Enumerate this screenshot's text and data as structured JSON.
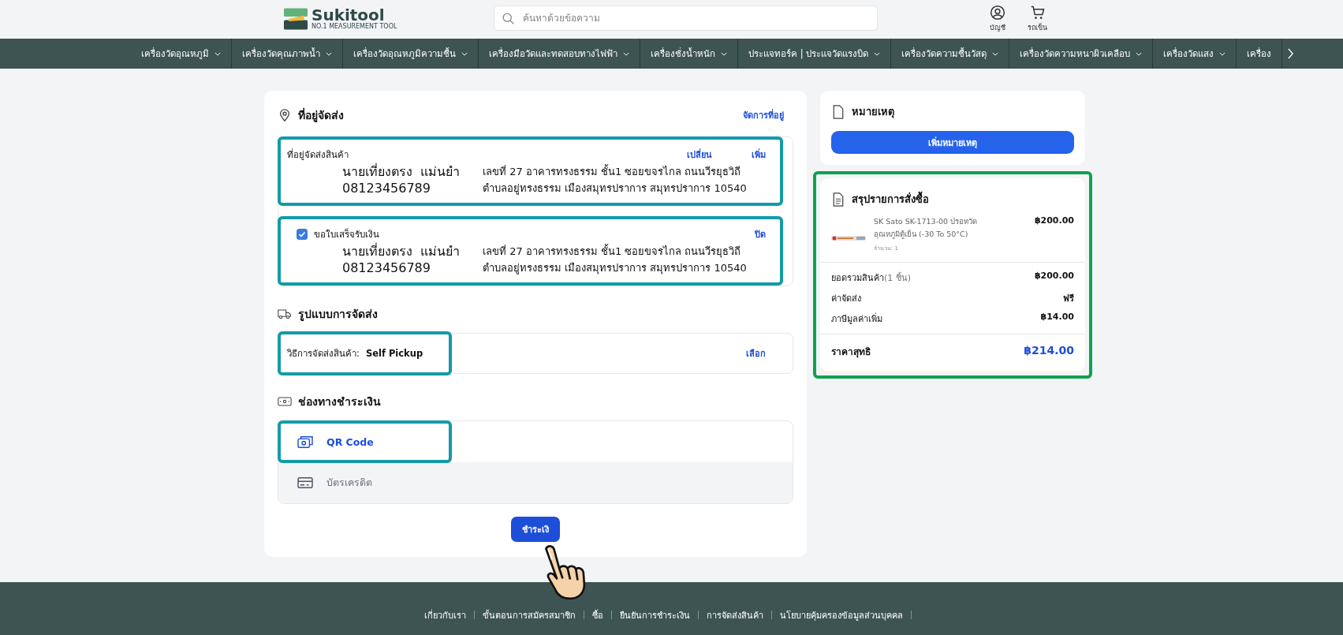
{
  "header": {
    "logo": {
      "name": "Sukitool",
      "tagline": "NO.1 MEASUREMENT TOOL"
    },
    "search": {
      "placeholder": "ค้นหาด้วยข้อความ"
    },
    "actions": [
      {
        "label": "บัญชี",
        "kind": "account"
      },
      {
        "label": "รถเข็น",
        "kind": "cart"
      }
    ]
  },
  "nav": {
    "items": [
      {
        "label": "เครื่องวัดอุณหภูมิ",
        "caret": true
      },
      {
        "label": "เครื่องวัดคุณภาพน้ำ",
        "caret": true
      },
      {
        "label": "เครื่องวัดอุณหภูมิความชื้น",
        "caret": true
      },
      {
        "label": "เครื่องมือวัดและทดสอบทางไฟฟ้า",
        "caret": true
      },
      {
        "label": "เครื่องชั่งน้ำหนัก",
        "caret": true
      },
      {
        "label": "ประแจทอร์ค | ประแจวัดแรงบิด",
        "caret": true
      },
      {
        "label": "เครื่องวัดความชื้นวัสดุ",
        "caret": true
      },
      {
        "label": "เครื่องวัดความหนาผิวเคลือบ",
        "caret": true
      },
      {
        "label": "เครื่องวัดแสง",
        "caret": true
      },
      {
        "label": "เครื่อง",
        "caret": false
      }
    ]
  },
  "address": {
    "title": "ที่อยู่จัดส่ง",
    "manage_link": "จัดการที่อยู่",
    "shipping_block": {
      "label": "ที่อยู่จัดส่งสินค้า",
      "links": [
        "เปลี่ยน",
        "เพิ่ม"
      ],
      "name": "นายเที่ยงตรง  แม่นยำ",
      "phone": "08123456789",
      "address_lines": [
        "เลขที่ 27 อาคารทรงธรรม ชั้น1 ซอยขจรไกล ถนนวีรยุธวิถี",
        "ตำบลอยู่ทรงธรรม เมืองสมุทรปราการ สมุทรปราการ 10540"
      ],
      "highlighted": true
    },
    "invoice_block": {
      "checked": true,
      "label": "ขอใบเสร็จรับเงิน",
      "link": "ปิด",
      "name": "นายเที่ยงตรง  แม่นยำ",
      "phone": "08123456789",
      "address_lines": [
        "เลขที่ 27 อาคารทรงธรรม ชั้น1 ซอยขจรไกล ถนนวีรยุธวิถี",
        "ตำบลอยู่ทรงธรรม เมืองสมุทรปราการ สมุทรปราการ 10540"
      ],
      "highlighted": true
    }
  },
  "shipping": {
    "title": "รูปแบบการจัดส่ง",
    "method_label": "วิธีการจัดส่งสินค้า:",
    "method_value": "Self Pickup",
    "choose_link": "เลือก",
    "highlighted": true
  },
  "payment": {
    "title": "ช่องทางชำระเงิน",
    "options": [
      {
        "label": "QR Code",
        "kind": "qr",
        "selected": true,
        "highlighted": true
      },
      {
        "label": "บัตรเครดิต",
        "kind": "card",
        "selected": false,
        "highlighted": false
      }
    ]
  },
  "pay_button": "ชำระเงิ",
  "note": {
    "title": "หมายเหตุ",
    "button": "เพิ่มหมายเหตุ"
  },
  "summary": {
    "title": "สรุปรายการสั่งซื้อ",
    "highlighted": true,
    "item": {
      "name": "SK Sato SK-1713-00 ปรอทวัด อุณหภูมิตู้เย็น (-30 To 50°C)",
      "qty": "จำนวน: 1",
      "price": "฿200.00"
    },
    "rows": [
      {
        "label": "ยอดรวมสินค้า",
        "note": "(1 ชิ้น)",
        "value": "฿200.00"
      },
      {
        "label": "ค่าจัดส่ง",
        "value": "ฟรี"
      },
      {
        "label": "ภาษีมูลค่าเพิ่ม",
        "value": "฿14.00"
      }
    ],
    "total": {
      "label": "ราคาสุทธิ",
      "value": "฿214.00"
    }
  },
  "footer": {
    "links": [
      "เกี่ยวกับเรา",
      "ขั้นตอนการสมัครสมาชิก",
      "ซื้อ",
      "ยืนยันการชำระเงิน",
      "การจัดส่งสินค้า",
      "นโยบายคุ้มครองข้อมูลส่วนบุคคล"
    ]
  }
}
